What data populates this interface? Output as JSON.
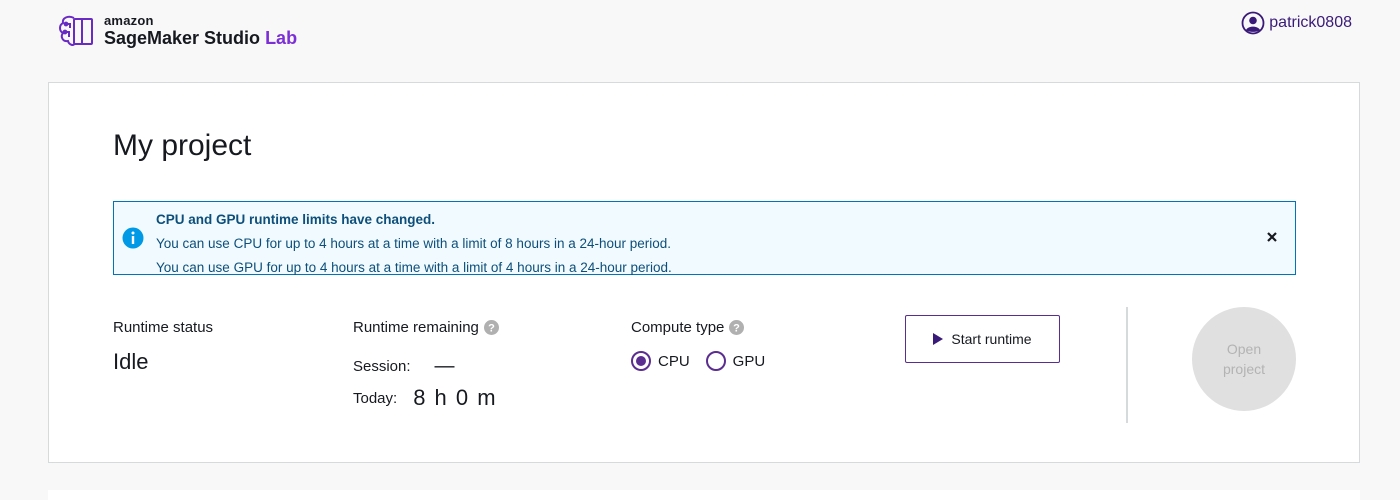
{
  "header": {
    "brand_top": "amazon",
    "brand_product": "SageMaker Studio",
    "brand_suffix": "Lab",
    "username": "patrick0808",
    "accent_color": "#7b2fd6"
  },
  "project": {
    "title": "My project"
  },
  "alert": {
    "heading": "CPU and GPU runtime limits have changed.",
    "line1": "You can use CPU for up to 4 hours at a time with a limit of 8 hours in a 24-hour period.",
    "line2": "You can use GPU for up to 4 hours at a time with a limit of 4 hours in a 24-hour period.",
    "icon": "info-icon"
  },
  "runtime_status": {
    "label": "Runtime status",
    "value": "Idle"
  },
  "runtime_remaining": {
    "label": "Runtime remaining",
    "session_label": "Session:",
    "session_value": "—",
    "today_label": "Today:",
    "today_value": "8 h 0 m"
  },
  "compute_type": {
    "label": "Compute type",
    "options": [
      "CPU",
      "GPU"
    ],
    "selected": "CPU"
  },
  "actions": {
    "start_label": "Start runtime",
    "open_label": "Open project"
  }
}
